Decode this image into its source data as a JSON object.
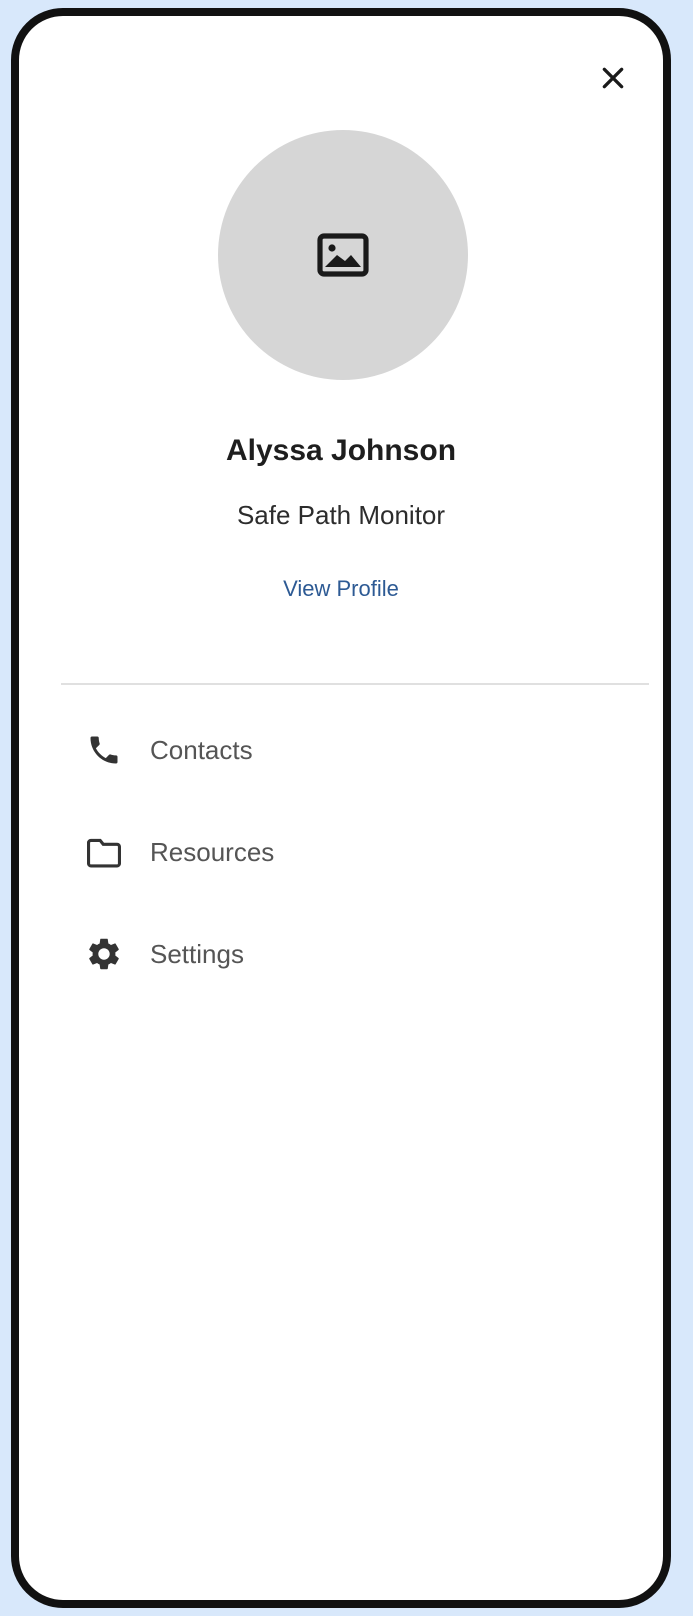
{
  "drawer": {
    "close_icon": "close-icon",
    "avatar_icon": "image-icon",
    "profile": {
      "name": "Alyssa Johnson",
      "role": "Safe Path Monitor",
      "link_label": "View Profile"
    },
    "menu": [
      {
        "label": "Contacts",
        "icon": "phone-icon"
      },
      {
        "label": "Resources",
        "icon": "folder-icon"
      },
      {
        "label": "Settings",
        "icon": "gear-icon"
      }
    ]
  },
  "colors": {
    "background": "#d8e8fb",
    "frame": "#111111",
    "avatar": "#d6d6d6",
    "link": "#2d5a94",
    "menu_text": "#555555",
    "divider": "#e0e0e0"
  }
}
